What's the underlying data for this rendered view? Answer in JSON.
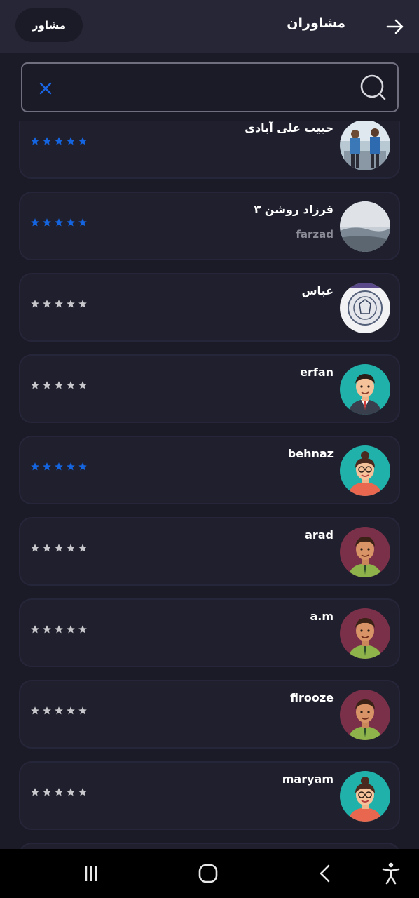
{
  "appbar": {
    "title": "مشاوران",
    "chip_label": "مشاور"
  },
  "search": {
    "value": "",
    "placeholder": ""
  },
  "colors": {
    "background": "#1b1b28",
    "appbar": "#262636",
    "card": "#1f1f2d",
    "accent_blue": "#1565e0",
    "star_gray": "#c8c8cc"
  },
  "advisors": [
    {
      "name": "حبیب علی آبادی",
      "username": "",
      "rating_color": "blue",
      "avatar": "photo-two-men"
    },
    {
      "name": "فرزاد روشن ۳",
      "username": "farzad",
      "rating_color": "blue",
      "avatar": "photo-landscape"
    },
    {
      "name": "عباس",
      "username": "",
      "rating_color": "gray",
      "avatar": "photo-emblem"
    },
    {
      "name": "erfan",
      "username": "",
      "rating_color": "gray",
      "avatar": "cartoon-man-suit"
    },
    {
      "name": "behnaz",
      "username": "",
      "rating_color": "blue",
      "avatar": "cartoon-woman-glasses"
    },
    {
      "name": "arad",
      "username": "",
      "rating_color": "gray",
      "avatar": "cartoon-man-green"
    },
    {
      "name": "a.m",
      "username": "",
      "rating_color": "gray",
      "avatar": "cartoon-man-green"
    },
    {
      "name": "firooze",
      "username": "",
      "rating_color": "gray",
      "avatar": "cartoon-man-green"
    },
    {
      "name": "maryam",
      "username": "",
      "rating_color": "gray",
      "avatar": "cartoon-woman-glasses"
    }
  ],
  "navbar": {
    "icons": [
      "recent-apps-icon",
      "home-icon",
      "back-icon",
      "accessibility-icon"
    ]
  }
}
